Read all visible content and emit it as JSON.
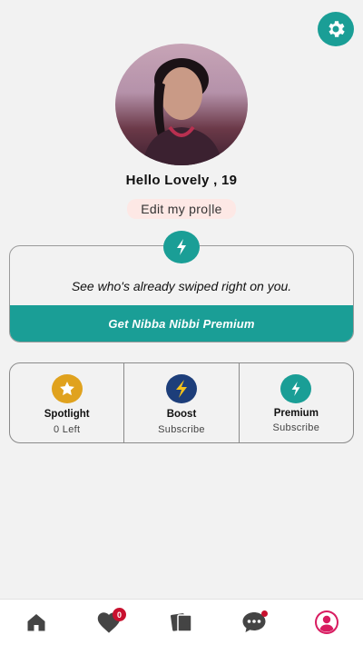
{
  "profile": {
    "greeting": "Hello Lovely  , 19",
    "edit_label": "Edit my pro|le"
  },
  "premium_card": {
    "text": "See who's already swiped right on you.",
    "cta": "Get Nibba Nibbi Premium"
  },
  "features": [
    {
      "title": "Spotlight",
      "subtitle": "0 Left",
      "icon": "star-icon",
      "color": "#e0a21e"
    },
    {
      "title": "Boost",
      "subtitle": "Subscribe",
      "icon": "lightning-icon",
      "color": "#1d3e7a"
    },
    {
      "title": "Premium",
      "subtitle": "Subscribe",
      "icon": "lightning-icon",
      "color": "#1a9e96"
    }
  ],
  "tabbar": {
    "likes_badge": "0",
    "tabs": [
      "home-icon",
      "heart-icon",
      "cards-icon",
      "chat-icon",
      "profile-icon"
    ]
  },
  "colors": {
    "accent": "#1a9e96",
    "badge": "#c8102e",
    "profile_tab": "#d81b60"
  }
}
